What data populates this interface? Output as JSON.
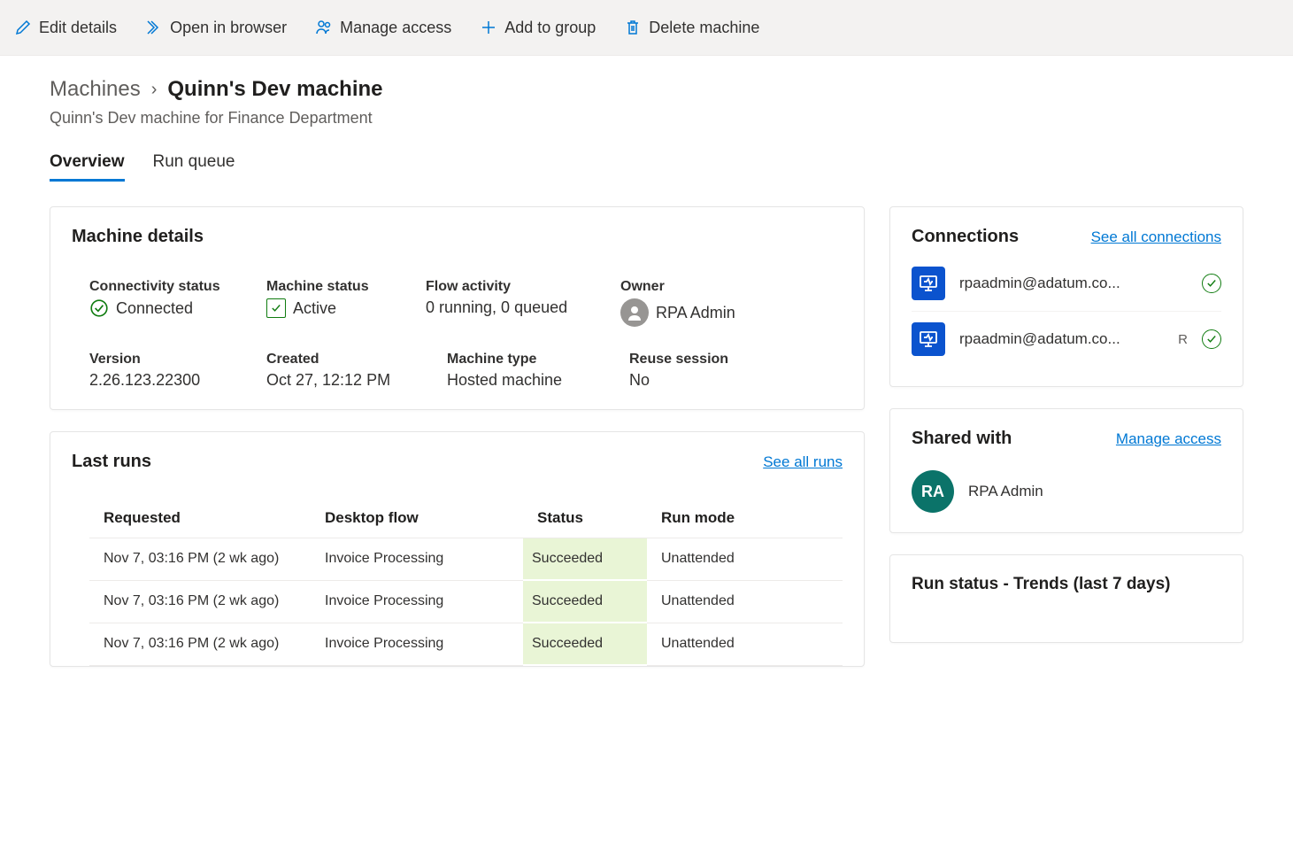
{
  "toolbar": {
    "edit": "Edit details",
    "open": "Open in browser",
    "manage": "Manage access",
    "add": "Add to group",
    "delete": "Delete machine"
  },
  "breadcrumb": {
    "root": "Machines",
    "current": "Quinn's Dev machine"
  },
  "subtitle": "Quinn's Dev machine for Finance Department",
  "tabs": {
    "overview": "Overview",
    "runqueue": "Run queue"
  },
  "machineDetails": {
    "title": "Machine details",
    "connectivity_label": "Connectivity status",
    "connectivity_value": "Connected",
    "status_label": "Machine status",
    "status_value": "Active",
    "flow_label": "Flow activity",
    "flow_value": "0 running, 0 queued",
    "owner_label": "Owner",
    "owner_value": "RPA Admin",
    "version_label": "Version",
    "version_value": "2.26.123.22300",
    "created_label": "Created",
    "created_value": "Oct 27, 12:12 PM",
    "type_label": "Machine type",
    "type_value": "Hosted machine",
    "reuse_label": "Reuse session",
    "reuse_value": "No"
  },
  "lastRuns": {
    "title": "Last runs",
    "link": "See all runs",
    "headers": {
      "requested": "Requested",
      "flow": "Desktop flow",
      "status": "Status",
      "mode": "Run mode"
    },
    "rows": [
      {
        "requested": "Nov 7, 03:16 PM (2 wk ago)",
        "flow": "Invoice Processing",
        "status": "Succeeded",
        "mode": "Unattended"
      },
      {
        "requested": "Nov 7, 03:16 PM (2 wk ago)",
        "flow": "Invoice Processing",
        "status": "Succeeded",
        "mode": "Unattended"
      },
      {
        "requested": "Nov 7, 03:16 PM (2 wk ago)",
        "flow": "Invoice Processing",
        "status": "Succeeded",
        "mode": "Unattended"
      }
    ]
  },
  "connections": {
    "title": "Connections",
    "link": "See all connections",
    "items": [
      {
        "label": "rpaadmin@adatum.co...",
        "extra": ""
      },
      {
        "label": "rpaadmin@adatum.co...",
        "extra": "R"
      }
    ]
  },
  "shared": {
    "title": "Shared with",
    "link": "Manage access",
    "avatar_initials": "RA",
    "name": "RPA Admin"
  },
  "runStatus": {
    "title": "Run status - Trends (last 7 days)"
  }
}
